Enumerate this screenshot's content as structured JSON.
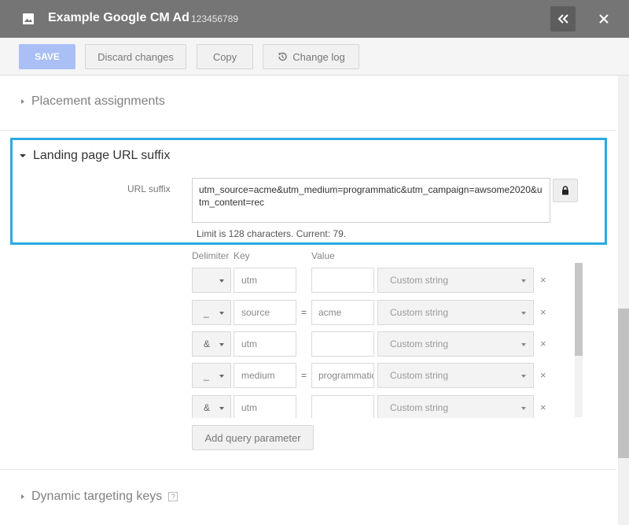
{
  "header": {
    "title": "Example Google CM Ad",
    "id": "123456789",
    "icons": {
      "doc": "image-icon",
      "collapse": "double-chevron-left-icon",
      "close": "close-icon"
    }
  },
  "toolbar": {
    "save_label": "SAVE",
    "discard_label": "Discard changes",
    "copy_label": "Copy",
    "changelog_label": "Change log"
  },
  "sections": {
    "placement": "Placement assignments",
    "landing": "Landing page URL suffix",
    "dynamic": "Dynamic targeting keys"
  },
  "url_suffix": {
    "label": "URL suffix",
    "value": "utm_source=acme&utm_medium=programmatic&utm_campaign=awsome2020&utm_content=rec",
    "limit_text": "Limit is 128 characters. Current: 79."
  },
  "params": {
    "headers": {
      "delimiter": "Delimiter",
      "key": "Key",
      "value": "Value"
    },
    "rows": [
      {
        "delimiter": "",
        "key": "utm",
        "eq": "",
        "value": "",
        "type": "Custom string"
      },
      {
        "delimiter": "_",
        "key": "source",
        "eq": "=",
        "value": "acme",
        "type": "Custom string"
      },
      {
        "delimiter": "&",
        "key": "utm",
        "eq": "",
        "value": "",
        "type": "Custom string"
      },
      {
        "delimiter": "_",
        "key": "medium",
        "eq": "=",
        "value": "programmatic",
        "type": "Custom string"
      },
      {
        "delimiter": "&",
        "key": "utm",
        "eq": "",
        "value": "",
        "type": "Custom string"
      }
    ],
    "add_label": "Add query parameter"
  },
  "help_glyph": "?",
  "remove_glyph": "×",
  "colors": {
    "accent": "#29abe2",
    "header_bg": "#757575",
    "save_bg": "#a9bff5"
  }
}
